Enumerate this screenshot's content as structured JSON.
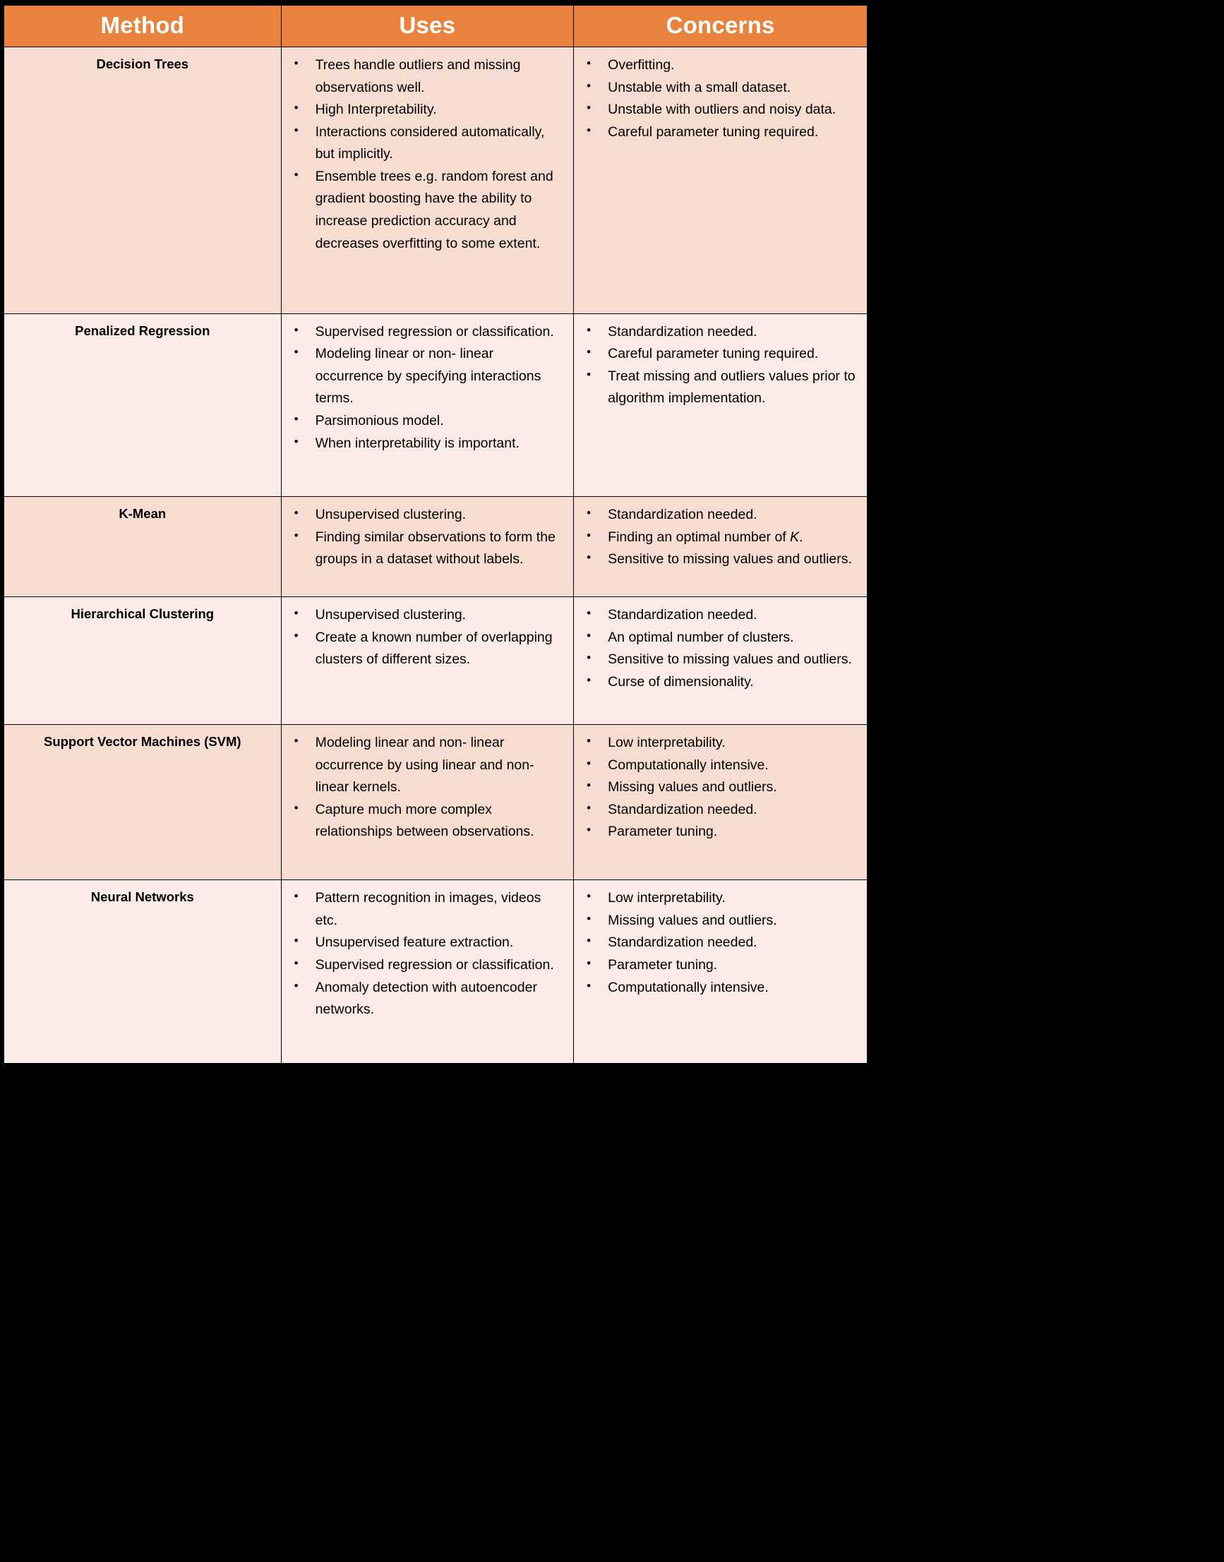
{
  "table": {
    "columns": [
      "Method",
      "Uses",
      "Concerns"
    ],
    "colors": {
      "header_bg": "#E8823C",
      "header_text": "#FFFFFF",
      "row_odd_bg": "#F7DCD1",
      "row_even_bg": "#FAEBE6",
      "border": "#000000",
      "text": "#000000"
    },
    "rows": [
      {
        "method": "Decision Trees",
        "uses": [
          "Trees handle outliers and missing observations well.",
          "High Interpretability.",
          "Interactions considered automatically, but implicitly.",
          "Ensemble trees e.g. random forest and gradient boosting have the ability to increase prediction accuracy and decreases overfitting to some extent."
        ],
        "concerns": [
          "Overfitting.",
          "Unstable with a small dataset.",
          "Unstable with outliers and noisy data.",
          "Careful parameter tuning required."
        ]
      },
      {
        "method": "Penalized Regression",
        "uses": [
          "Supervised regression or classification.",
          "Modeling linear or non- linear occurrence by specifying interactions terms.",
          "Parsimonious model.",
          "When interpretability is important."
        ],
        "concerns": [
          "Standardization needed.",
          "Careful parameter tuning required.",
          "Treat missing and outliers values prior to algorithm implementation."
        ]
      },
      {
        "method": "K-Mean",
        "uses": [
          "Unsupervised clustering.",
          "Finding similar observations to form the groups in a dataset without labels."
        ],
        "concerns": [
          "Standardization needed.",
          "Finding an optimal number of <em>K</em>.",
          "Sensitive to missing values and outliers."
        ]
      },
      {
        "method": "Hierarchical Clustering",
        "uses": [
          "Unsupervised clustering.",
          "Create a known number of overlapping clusters of different sizes."
        ],
        "concerns": [
          "Standardization needed.",
          "An optimal number of clusters.",
          "Sensitive to missing values and outliers.",
          "Curse of dimensionality."
        ]
      },
      {
        "method": "Support Vector Machines (SVM)",
        "uses": [
          "Modeling linear and non- linear occurrence by using linear and non-linear kernels.",
          "Capture much more complex relationships between observations."
        ],
        "concerns": [
          "Low interpretability.",
          "Computationally intensive.",
          "Missing values and outliers.",
          "Standardization needed.",
          "Parameter tuning."
        ]
      },
      {
        "method": "Neural Networks",
        "uses": [
          "Pattern recognition in images, videos etc.",
          "Unsupervised feature extraction.",
          "Supervised regression or classification.",
          "Anomaly detection with autoencoder networks."
        ],
        "concerns": [
          "Low interpretability.",
          "Missing values and outliers.",
          "Standardization needed.",
          "Parameter tuning.",
          "Computationally intensive."
        ]
      }
    ]
  }
}
